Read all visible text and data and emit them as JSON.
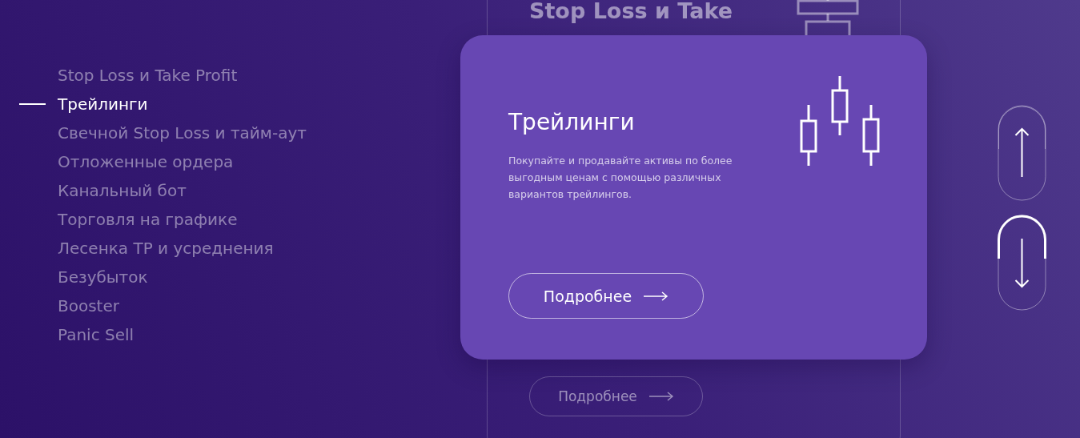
{
  "nav": {
    "items": [
      {
        "label": "Stop Loss и Take Profit",
        "selected": false
      },
      {
        "label": "Трейлинги",
        "selected": true
      },
      {
        "label": "Свечной Stop Loss и тайм-аут",
        "selected": false
      },
      {
        "label": "Отложенные ордера",
        "selected": false
      },
      {
        "label": "Канальный бот",
        "selected": false
      },
      {
        "label": "Торговля на графике",
        "selected": false
      },
      {
        "label": "Лесенка TP и усреднения",
        "selected": false
      },
      {
        "label": "Безубыток",
        "selected": false
      },
      {
        "label": "Booster",
        "selected": false
      },
      {
        "label": "Panic Sell",
        "selected": false
      }
    ]
  },
  "back_card": {
    "title": "Stop Loss и Take",
    "button": "Подробнее"
  },
  "card": {
    "title": "Трейлинги",
    "description": "Покупайте и продавайте активы по более выгодным ценам с помощью различных вариантов трейлингов.",
    "button": "Подробнее"
  },
  "arrows": [
    {
      "kind": "up",
      "selected": false
    },
    {
      "kind": "down",
      "selected": true
    }
  ]
}
